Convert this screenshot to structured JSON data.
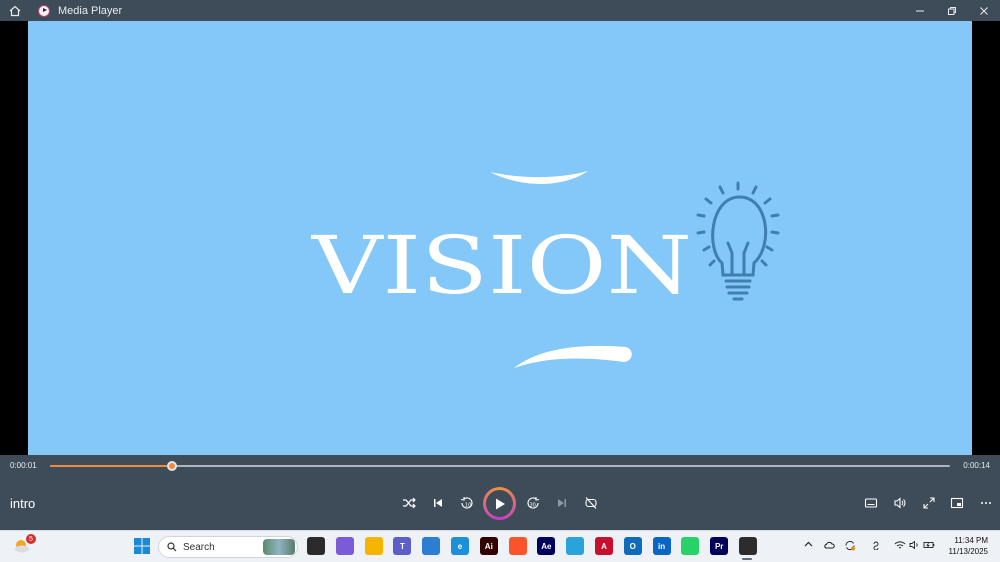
{
  "window": {
    "title": "Media Player"
  },
  "video": {
    "headline": "VISION"
  },
  "playback": {
    "current_time": "0:00:01",
    "total_time": "0:00:14",
    "progress": 0.136,
    "media_title": "intro"
  },
  "taskbar": {
    "search_placeholder": "Search",
    "weather_badge": "5",
    "clock_time": "11:34 PM",
    "clock_date": "11/13/2025",
    "apps": [
      {
        "name": "taskview",
        "label": "",
        "color": "#2b2b2b"
      },
      {
        "name": "copilot",
        "label": "",
        "color": "#7b5cd6"
      },
      {
        "name": "file-explorer",
        "label": "",
        "color": "#f4b400"
      },
      {
        "name": "teams",
        "label": "T",
        "color": "#5b5fc7"
      },
      {
        "name": "store",
        "label": "",
        "color": "#2d7dd2"
      },
      {
        "name": "edge",
        "label": "e",
        "color": "#1c8fd8"
      },
      {
        "name": "illustrator",
        "label": "Ai",
        "color": "#330000"
      },
      {
        "name": "brave",
        "label": "",
        "color": "#fb542b"
      },
      {
        "name": "after-effects",
        "label": "Ae",
        "color": "#00005b"
      },
      {
        "name": "telegram",
        "label": "",
        "color": "#2aa3dd"
      },
      {
        "name": "acrobat",
        "label": "A",
        "color": "#c8102e"
      },
      {
        "name": "outlook",
        "label": "O",
        "color": "#0f6cbd"
      },
      {
        "name": "linkedin",
        "label": "in",
        "color": "#0a66c2"
      },
      {
        "name": "whatsapp",
        "label": "",
        "color": "#25d366"
      },
      {
        "name": "premiere",
        "label": "Pr",
        "color": "#00005b"
      },
      {
        "name": "media-player",
        "label": "",
        "color": "#2c2c2c"
      }
    ]
  },
  "colors": {
    "chrome": "#3e4b59",
    "video_bg": "#84c7f9",
    "accent": "#f08a3c",
    "bulb": "#3f7fb0"
  }
}
